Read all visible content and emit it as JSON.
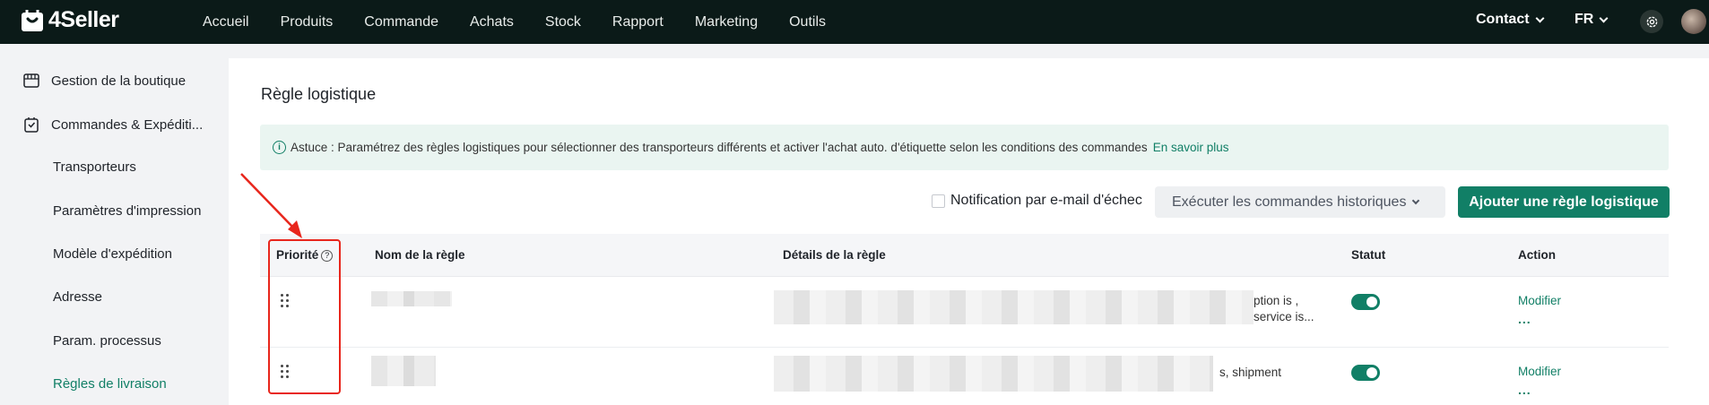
{
  "app": {
    "brand": "4Seller",
    "accent_color": "#117f66",
    "nav_bg": "#0b1a18"
  },
  "nav": {
    "items": [
      "Accueil",
      "Produits",
      "Commande",
      "Achats",
      "Stock",
      "Rapport",
      "Marketing",
      "Outils"
    ],
    "contact_label": "Contact",
    "lang_label": "FR"
  },
  "sidebar": {
    "group1": "Gestion de la boutique",
    "group2": "Commandes & Expéditi...",
    "items": [
      "Transporteurs",
      "Paramètres d'impression",
      "Modèle d'expédition",
      "Adresse",
      "Param. processus",
      "Règles de livraison"
    ],
    "active": "Règles de livraison"
  },
  "page": {
    "title": "Règle logistique",
    "tip_prefix": "Astuce : Paramétrez des règles logistiques pour sélectionner des transporteurs différents et activer l'achat auto. d'étiquette selon les conditions des commandes",
    "tip_link": "En savoir plus",
    "notif_label": "Notification par e-mail d'échec",
    "exec_label": "Exécuter les commandes historiques",
    "add_label": "Ajouter une règle logistique"
  },
  "table": {
    "headers": {
      "priority": "Priorité",
      "name": "Nom de la règle",
      "details": "Détails de la règle",
      "status": "Statut",
      "action": "Action"
    },
    "rows": [
      {
        "details_visible": "ption is ,\nservice is...",
        "status_on": true,
        "action": "Modifier",
        "more": "..."
      },
      {
        "details_visible": "s, shipment",
        "status_on": true,
        "action": "Modifier",
        "more": "..."
      }
    ]
  },
  "annotation": {
    "color": "#e8261c"
  }
}
